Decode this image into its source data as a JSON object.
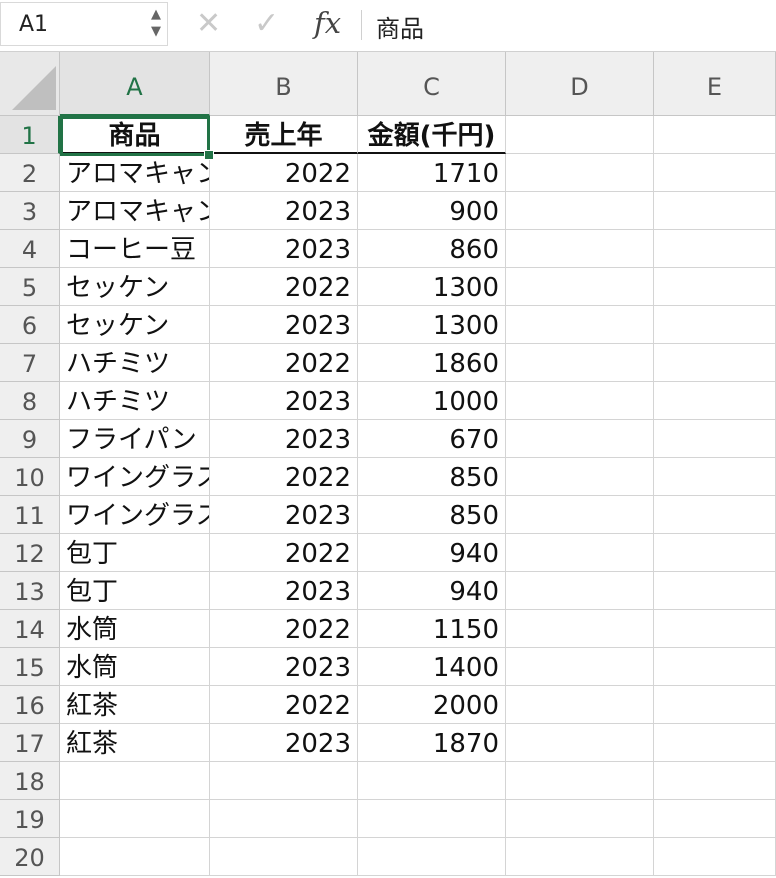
{
  "name_box": {
    "value": "A1"
  },
  "formula_bar": {
    "cancel_icon": "x-icon",
    "confirm_icon": "check-icon",
    "fx_label": "fx",
    "content": "商品"
  },
  "columns": [
    "A",
    "B",
    "C",
    "D",
    "E"
  ],
  "rows": [
    "1",
    "2",
    "3",
    "4",
    "5",
    "6",
    "7",
    "8",
    "9",
    "10",
    "11",
    "12",
    "13",
    "14",
    "15",
    "16",
    "17",
    "18",
    "19",
    "20"
  ],
  "header": [
    "商品",
    "売上年",
    "金額(千円)"
  ],
  "data": [
    [
      "アロマキャン",
      "2022",
      "1710"
    ],
    [
      "アロマキャン",
      "2023",
      "900"
    ],
    [
      "コーヒー豆",
      "2023",
      "860"
    ],
    [
      "セッケン",
      "2022",
      "1300"
    ],
    [
      "セッケン",
      "2023",
      "1300"
    ],
    [
      "ハチミツ",
      "2022",
      "1860"
    ],
    [
      "ハチミツ",
      "2023",
      "1000"
    ],
    [
      "フライパン",
      "2023",
      "670"
    ],
    [
      "ワイングラス",
      "2022",
      "850"
    ],
    [
      "ワイングラス",
      "2023",
      "850"
    ],
    [
      "包丁",
      "2022",
      "940"
    ],
    [
      "包丁",
      "2023",
      "940"
    ],
    [
      "水筒",
      "2022",
      "1150"
    ],
    [
      "水筒",
      "2023",
      "1400"
    ],
    [
      "紅茶",
      "2022",
      "2000"
    ],
    [
      "紅茶",
      "2023",
      "1870"
    ]
  ],
  "colors": {
    "selection": "#217346"
  }
}
